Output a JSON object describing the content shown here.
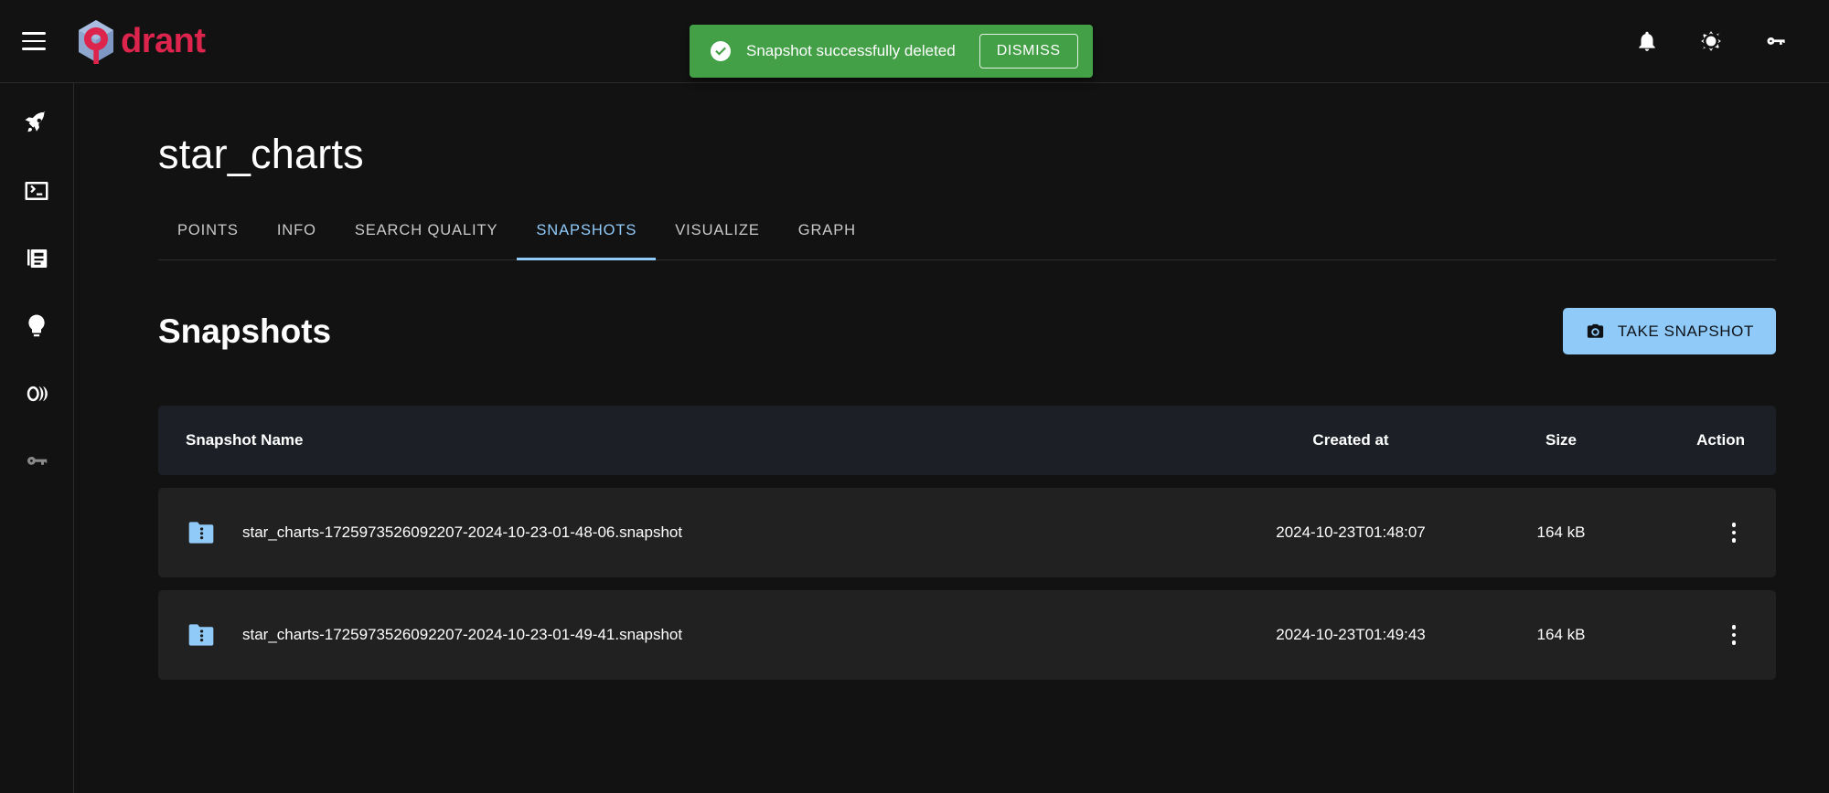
{
  "app": {
    "brand_name": "drant",
    "brand_color": "#dc244c",
    "menu_icon": "hamburger-menu-icon",
    "logo_icon": "qdrant-logo-icon"
  },
  "appbar": {
    "actions": [
      {
        "icon": "bell-icon",
        "label": "Notifications"
      },
      {
        "icon": "sun-icon",
        "label": "Toggle theme"
      },
      {
        "icon": "key-icon",
        "label": "API key"
      }
    ]
  },
  "toast": {
    "icon": "check-circle-icon",
    "message": "Snapshot successfully deleted",
    "dismiss_label": "DISMISS",
    "background": "#43a047"
  },
  "sidebar": {
    "items": [
      {
        "icon": "rocket-icon",
        "label": "Welcome",
        "dim": false
      },
      {
        "icon": "console-icon",
        "label": "Console",
        "dim": false
      },
      {
        "icon": "collections-icon",
        "label": "Collections",
        "dim": false
      },
      {
        "icon": "lightbulb-icon",
        "label": "Tutorial",
        "dim": false
      },
      {
        "icon": "datasets-icon",
        "label": "Datasets",
        "dim": false
      },
      {
        "icon": "key-icon",
        "label": "API Key",
        "dim": true
      }
    ]
  },
  "page": {
    "title": "star_charts"
  },
  "tabs": [
    {
      "label": "POINTS",
      "active": false
    },
    {
      "label": "INFO",
      "active": false
    },
    {
      "label": "SEARCH QUALITY",
      "active": false
    },
    {
      "label": "SNAPSHOTS",
      "active": true
    },
    {
      "label": "VISUALIZE",
      "active": false
    },
    {
      "label": "GRAPH",
      "active": false
    }
  ],
  "section": {
    "title": "Snapshots",
    "take_snapshot_label": "TAKE SNAPSHOT",
    "take_snapshot_icon": "camera-icon",
    "accent_color": "#90caf9"
  },
  "table": {
    "columns": {
      "name": "Snapshot Name",
      "created_at": "Created at",
      "size": "Size",
      "action": "Action"
    },
    "rows": [
      {
        "icon": "snapshot-folder-icon",
        "name": "star_charts-1725973526092207-2024-10-23-01-48-06.snapshot",
        "created_at": "2024-10-23T01:48:07",
        "size": "164 kB",
        "action_icon": "more-vertical-icon"
      },
      {
        "icon": "snapshot-folder-icon",
        "name": "star_charts-1725973526092207-2024-10-23-01-49-41.snapshot",
        "created_at": "2024-10-23T01:49:43",
        "size": "164 kB",
        "action_icon": "more-vertical-icon"
      }
    ]
  }
}
